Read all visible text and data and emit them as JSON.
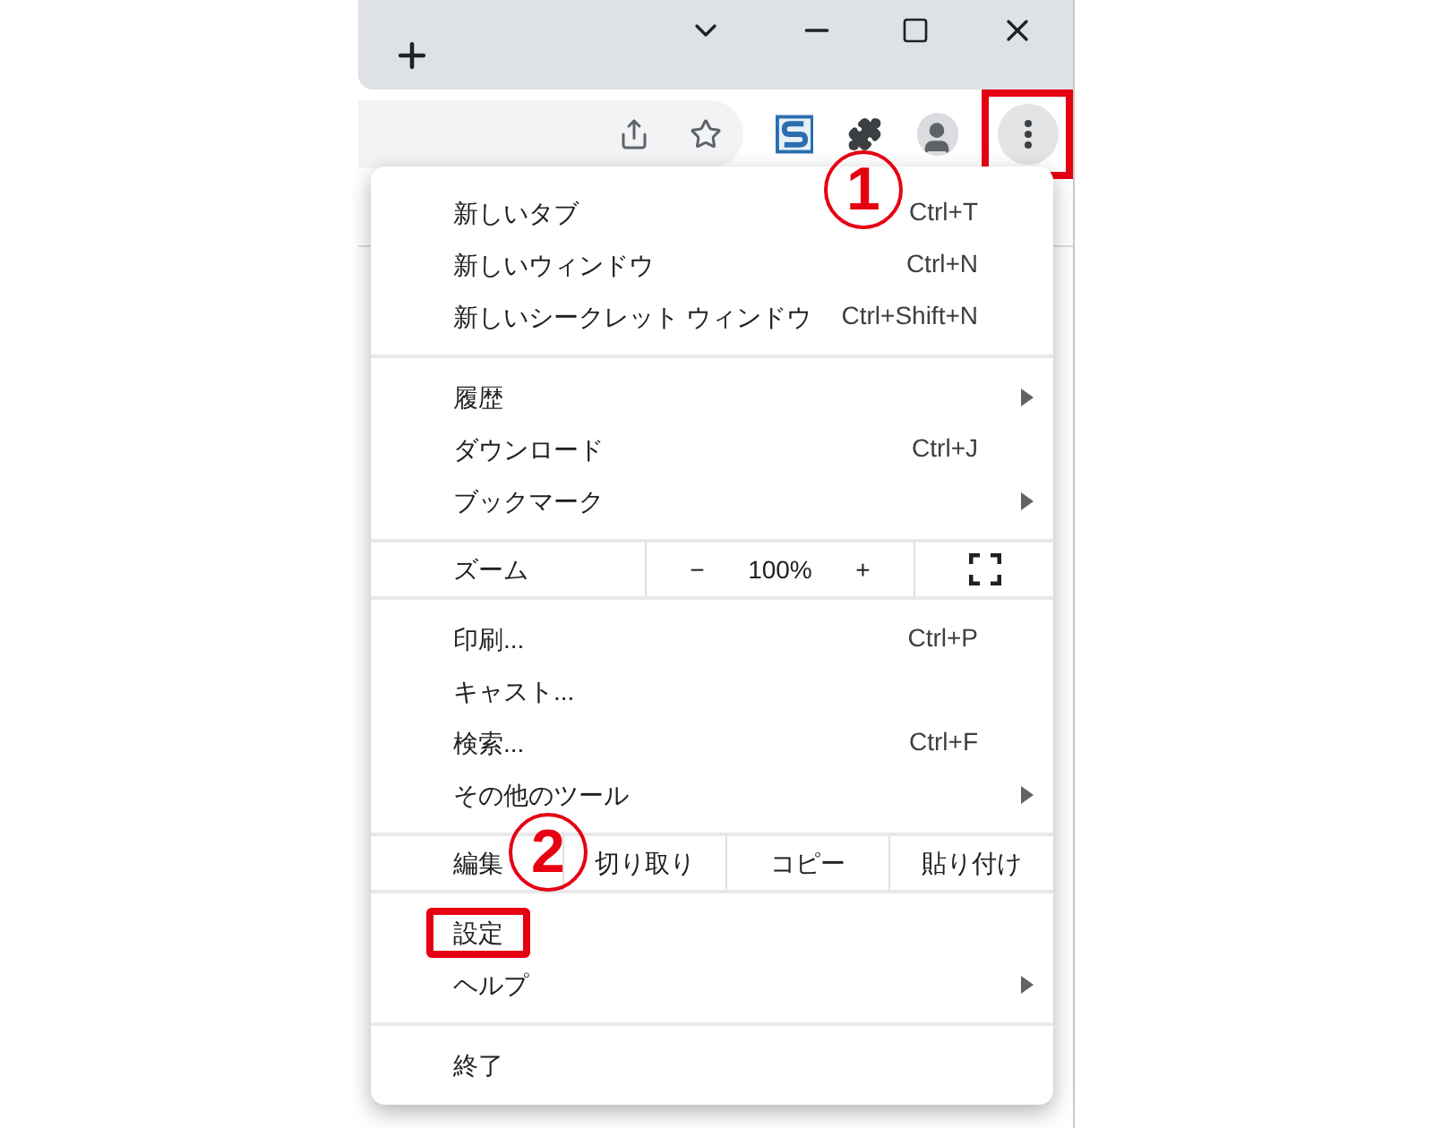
{
  "menu": {
    "sections": [
      {
        "kind": "items",
        "items": [
          {
            "label": "新しいタブ",
            "shortcut": "Ctrl+T",
            "submenu": false,
            "highlighted": false
          },
          {
            "label": "新しいウィンドウ",
            "shortcut": "Ctrl+N",
            "submenu": false,
            "highlighted": false
          },
          {
            "label": "新しいシークレット ウィンドウ",
            "shortcut": "Ctrl+Shift+N",
            "submenu": false,
            "highlighted": false
          }
        ]
      },
      {
        "kind": "items",
        "items": [
          {
            "label": "履歴",
            "submenu": true,
            "highlighted": false
          },
          {
            "label": "ダウンロード",
            "shortcut": "Ctrl+J",
            "submenu": false,
            "highlighted": false
          },
          {
            "label": "ブックマーク",
            "submenu": true,
            "highlighted": false
          }
        ]
      },
      {
        "kind": "zoom",
        "label": "ズーム",
        "minus": "−",
        "value": "100%",
        "plus": "+"
      },
      {
        "kind": "items",
        "items": [
          {
            "label": "印刷...",
            "shortcut": "Ctrl+P",
            "submenu": false,
            "highlighted": false
          },
          {
            "label": "キャスト...",
            "submenu": false,
            "highlighted": false
          },
          {
            "label": "検索...",
            "shortcut": "Ctrl+F",
            "submenu": false,
            "highlighted": false
          },
          {
            "label": "その他のツール",
            "submenu": true,
            "highlighted": false
          }
        ]
      },
      {
        "kind": "edit",
        "label": "編集",
        "buttons": [
          "切り取り",
          "コピー",
          "貼り付け"
        ]
      },
      {
        "kind": "items",
        "items": [
          {
            "label": "設定",
            "submenu": false,
            "highlighted": true
          },
          {
            "label": "ヘルプ",
            "submenu": true,
            "highlighted": false
          }
        ]
      },
      {
        "kind": "items",
        "items": [
          {
            "label": "終了",
            "submenu": false,
            "highlighted": false
          }
        ]
      }
    ]
  },
  "annotations": [
    {
      "label": "1"
    },
    {
      "label": "2"
    }
  ]
}
